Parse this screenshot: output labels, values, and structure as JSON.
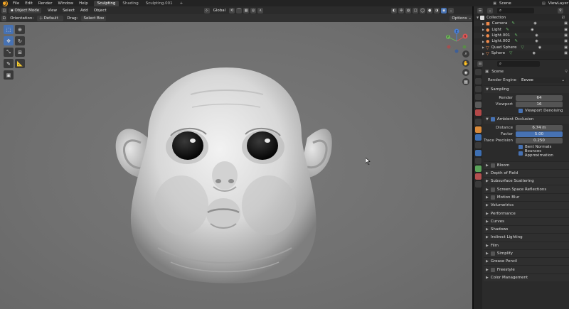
{
  "topbar": {
    "menus": [
      "File",
      "Edit",
      "Render",
      "Window",
      "Help"
    ],
    "workspaces": [
      "Sculpting",
      "Shading",
      "Sculpting.001"
    ],
    "add_tab": "+",
    "scene": "Scene",
    "view_layer": "ViewLayer"
  },
  "viewport_header": {
    "mode": "Object Mode",
    "menus": [
      "View",
      "Select",
      "Add",
      "Object"
    ],
    "transform": "Global"
  },
  "tool_settings": {
    "orientation_label": "Orientation:",
    "orientation_value": "Default",
    "drag_label": "Drag:",
    "drag_value": "Select Box",
    "options": "Options"
  },
  "gizmo": {
    "x": "X",
    "y": "Y",
    "z": "Z"
  },
  "outliner": {
    "collection": "Collection",
    "items": [
      {
        "name": "Camera",
        "icon_color": "#c8c8c8",
        "mod_color": "#6cbf6c"
      },
      {
        "name": "Light",
        "icon_color": "#c8c8c8",
        "mod_color": "#6cbf6c"
      },
      {
        "name": "Light.001",
        "icon_color": "#c8c8c8",
        "mod_color": "#6cbf6c"
      },
      {
        "name": "Light.002",
        "icon_color": "#c8c8c8",
        "mod_color": "#6cbf6c"
      },
      {
        "name": "Quad Sphere",
        "icon_color": "#f08a4b",
        "mod_color": "#6cbf6c"
      },
      {
        "name": "Sphere",
        "icon_color": "#f08a4b",
        "mod_color": "#6cbf6c"
      }
    ]
  },
  "properties": {
    "breadcrumb": "Scene",
    "render_engine_label": "Render Engine",
    "render_engine_value": "Eevee",
    "sampling": {
      "title": "Sampling",
      "render_label": "Render",
      "render_value": "64",
      "viewport_label": "Viewport",
      "viewport_value": "16",
      "denoise_label": "Viewport Denoising"
    },
    "ao": {
      "title": "Ambient Occlusion",
      "distance_label": "Distance",
      "distance_value": "6.74 m",
      "factor_label": "Factor",
      "factor_value": "5.00",
      "trace_label": "Trace Precision",
      "trace_value": "0.250",
      "bent_label": "Bent Normals",
      "bounces_label": "Bounces Approximation"
    },
    "sections": [
      {
        "label": "Bloom",
        "checkbox": true
      },
      {
        "label": "Depth of Field",
        "checkbox": false
      },
      {
        "label": "Subsurface Scattering",
        "checkbox": false
      },
      {
        "label": "Screen Space Reflections",
        "checkbox": true
      },
      {
        "label": "Motion Blur",
        "checkbox": true
      },
      {
        "label": "Volumetrics",
        "checkbox": false
      },
      {
        "label": "Performance",
        "checkbox": false
      },
      {
        "label": "Curves",
        "checkbox": false
      },
      {
        "label": "Shadows",
        "checkbox": false
      },
      {
        "label": "Indirect Lighting",
        "checkbox": false
      },
      {
        "label": "Film",
        "checkbox": false
      },
      {
        "label": "Simplify",
        "checkbox": true
      },
      {
        "label": "Grease Pencil",
        "checkbox": false
      },
      {
        "label": "Freestyle",
        "checkbox": true
      },
      {
        "label": "Color Management",
        "checkbox": false
      }
    ]
  }
}
